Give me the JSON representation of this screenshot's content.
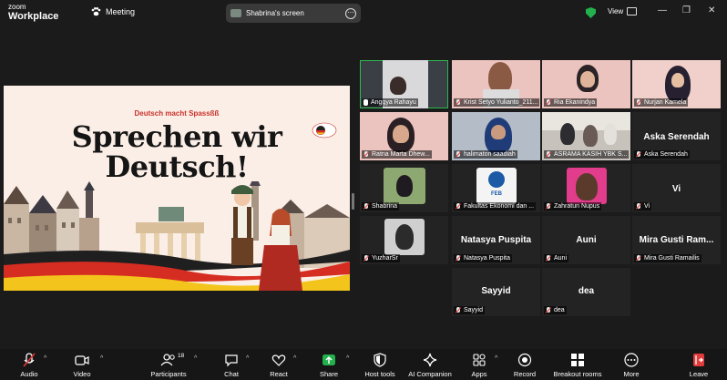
{
  "app": {
    "brand_line1": "zoom",
    "brand_line2": "Workplace",
    "meeting_label": "Meeting"
  },
  "share": {
    "title": "Shabrina's screen",
    "menu": "⋯"
  },
  "view_label": "View",
  "window_controls": {
    "minimize": "—",
    "maximize": "□",
    "restore": "❐",
    "close": "✕"
  },
  "slide": {
    "tagline": "Deutsch macht Spassßß",
    "title_line1": "Sprechen wir",
    "title_line2": "Deutsch!"
  },
  "tiles": [
    {
      "name": "Anggya Rahayu",
      "muted": false,
      "video": true,
      "active": true
    },
    {
      "name": "Krist Setyo Yulianto_211...",
      "muted": true,
      "video": true
    },
    {
      "name": "Ria Ekanindya",
      "muted": true,
      "video": true
    },
    {
      "name": "Nurjan Kamela",
      "muted": true,
      "video": true
    },
    {
      "name": "Ratna Marta Dhew...",
      "muted": true,
      "video": true
    },
    {
      "name": "halimaton saadiah",
      "muted": true,
      "video": true
    },
    {
      "name": "ASRAMA KASIH YBK S...",
      "muted": true,
      "video": true
    },
    {
      "name": "Aska Serendah",
      "muted": true,
      "video": false,
      "display": "Aska Serendah"
    },
    {
      "name": "Shabrina",
      "muted": true,
      "video": false
    },
    {
      "name": "Fakultas Ekonomi dan ...",
      "muted": true,
      "video": false
    },
    {
      "name": "Zahratun Nupus",
      "muted": true,
      "video": false
    },
    {
      "name": "Vi",
      "muted": true,
      "video": false,
      "display": "Vi"
    },
    {
      "name": "YuzharSr",
      "muted": true,
      "video": false
    },
    {
      "name": "Natasya Puspita",
      "muted": true,
      "video": false,
      "display": "Natasya Puspita"
    },
    {
      "name": "Auni",
      "muted": true,
      "video": false,
      "display": "Auni"
    },
    {
      "name": "Mira Gusti Ramailis",
      "muted": true,
      "video": false,
      "display": "Mira  Gusti  Ram..."
    },
    {
      "name": "Sayyid",
      "muted": true,
      "video": false,
      "display": "Sayyid"
    },
    {
      "name": "dea",
      "muted": true,
      "video": false,
      "display": "dea"
    }
  ],
  "toolbar": {
    "audio": "Audio",
    "video": "Video",
    "participants": "Participants",
    "participants_count": "18",
    "chat": "Chat",
    "react": "React",
    "share": "Share",
    "host_tools": "Host tools",
    "ai_companion": "AI Companion",
    "apps": "Apps",
    "record": "Record",
    "breakout_rooms": "Breakout rooms",
    "more": "More",
    "leave": "Leave",
    "caret": "^"
  },
  "colors": {
    "active_border": "#2db84c",
    "share_green": "#23b14d",
    "muted_red": "#e23b3b",
    "slide_red": "#c8322c"
  }
}
